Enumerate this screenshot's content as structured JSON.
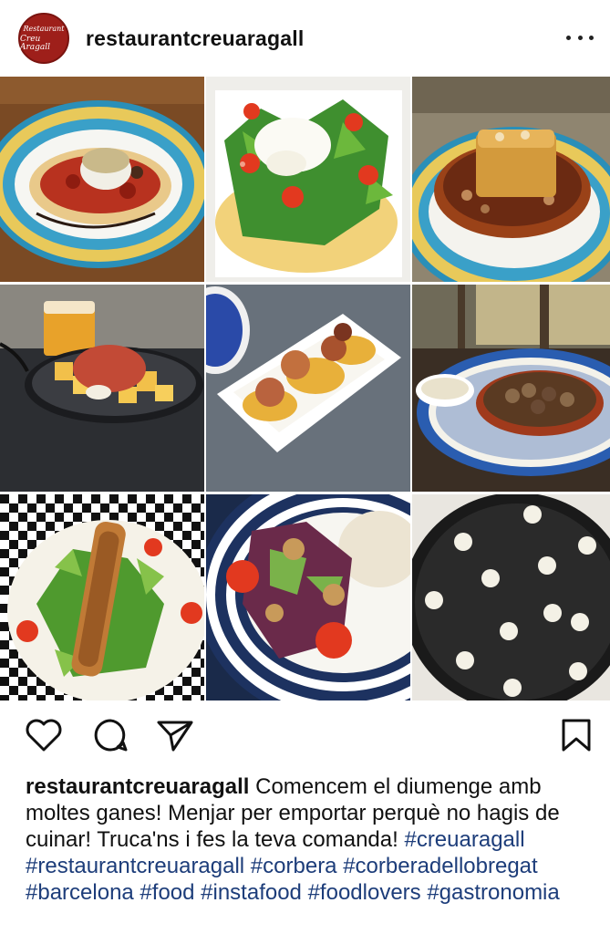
{
  "post": {
    "avatar_line1": "Restaurant",
    "avatar_line2": "Creu Aragall",
    "username": "restaurantcreuaragall",
    "more_icon": "more-horizontal-icon"
  },
  "grid": {
    "images": [
      "goat-cheese-coca",
      "burrata-salad",
      "cake-with-nuts",
      "patatas-bravas",
      "octopus-on-potato",
      "snails-cassola",
      "crispy-chicken-salad",
      "walnut-salad",
      "black-rice-paella"
    ]
  },
  "actions": {
    "like_icon": "heart-icon",
    "comment_icon": "comment-icon",
    "share_icon": "send-icon",
    "save_icon": "bookmark-icon"
  },
  "caption": {
    "username": "restaurantcreuaragall",
    "text": " Comencem el diumenge amb moltes ganes! Menjar per emportar perquè no hagis de cuinar! Truca'ns i fes la teva comanda!",
    "hashtags": "#creuaragall #restaurantcreuaragall #corbera #corberadellobregat #barcelona #food #instafood #foodlovers #gastronomia"
  }
}
